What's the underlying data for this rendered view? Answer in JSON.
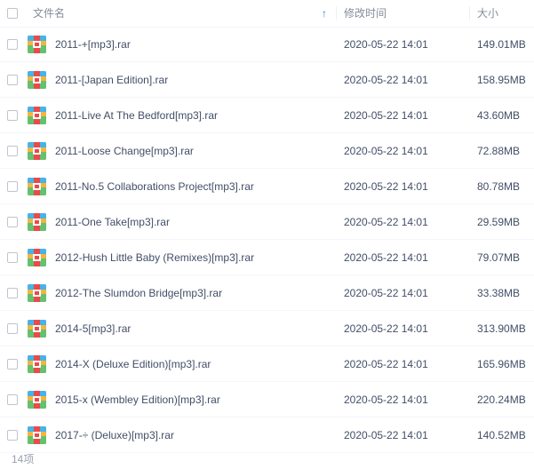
{
  "header": {
    "name_label": "文件名",
    "time_label": "修改时间",
    "size_label": "大小",
    "sort_arrow": "↑"
  },
  "files": [
    {
      "name": "2011-+[mp3].rar",
      "time": "2020-05-22 14:01",
      "size": "149.01MB",
      "icon": "archive-icon"
    },
    {
      "name": "2011-[Japan Edition].rar",
      "time": "2020-05-22 14:01",
      "size": "158.95MB",
      "icon": "archive-icon"
    },
    {
      "name": "2011-Live At The Bedford[mp3].rar",
      "time": "2020-05-22 14:01",
      "size": "43.60MB",
      "icon": "archive-icon"
    },
    {
      "name": "2011-Loose Change[mp3].rar",
      "time": "2020-05-22 14:01",
      "size": "72.88MB",
      "icon": "archive-icon"
    },
    {
      "name": "2011-No.5 Collaborations Project[mp3].rar",
      "time": "2020-05-22 14:01",
      "size": "80.78MB",
      "icon": "archive-icon"
    },
    {
      "name": "2011-One Take[mp3].rar",
      "time": "2020-05-22 14:01",
      "size": "29.59MB",
      "icon": "archive-icon"
    },
    {
      "name": "2012-Hush Little Baby (Remixes)[mp3].rar",
      "time": "2020-05-22 14:01",
      "size": "79.07MB",
      "icon": "archive-icon"
    },
    {
      "name": "2012-The Slumdon Bridge[mp3].rar",
      "time": "2020-05-22 14:01",
      "size": "33.38MB",
      "icon": "archive-icon"
    },
    {
      "name": "2014-5[mp3].rar",
      "time": "2020-05-22 14:01",
      "size": "313.90MB",
      "icon": "archive-icon"
    },
    {
      "name": "2014-X (Deluxe Edition)[mp3].rar",
      "time": "2020-05-22 14:01",
      "size": "165.96MB",
      "icon": "archive-icon"
    },
    {
      "name": "2015-x (Wembley Edition)[mp3].rar",
      "time": "2020-05-22 14:01",
      "size": "220.24MB",
      "icon": "archive-icon"
    },
    {
      "name": "2017-÷ (Deluxe)[mp3].rar",
      "time": "2020-05-22 14:01",
      "size": "140.52MB",
      "icon": "archive-icon"
    }
  ],
  "footer": {
    "count_label": "14项"
  },
  "colors": {
    "accent": "#1a86f2",
    "text": "#424e67",
    "muted": "#878c9c"
  }
}
